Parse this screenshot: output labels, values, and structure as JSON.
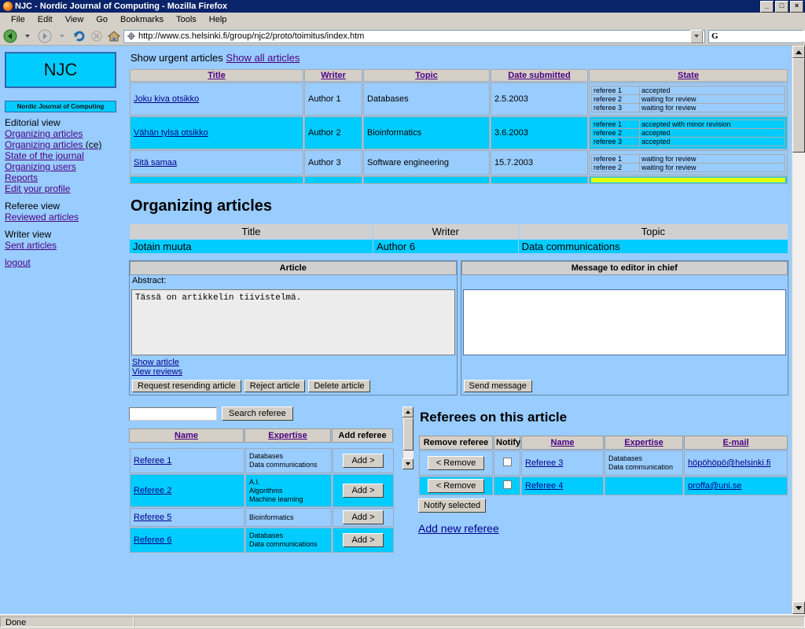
{
  "window": {
    "title": "NJC - Nordic Journal of Computing - Mozilla Firefox",
    "minimize_label": "_",
    "maximize_label": "□",
    "close_label": "×"
  },
  "menubar": {
    "items": [
      "File",
      "Edit",
      "View",
      "Go",
      "Bookmarks",
      "Tools",
      "Help"
    ]
  },
  "navbar": {
    "url": "http://www.cs.helsinki.fi/group/njc2/proto/toimitus/index.htm",
    "search_placeholder": "",
    "search_value": "",
    "google_icon_label": "G"
  },
  "sidebar": {
    "logo": "NJC",
    "subtitle": "Nordic Journal of Computing",
    "groups": [
      {
        "heading": "Editorial view",
        "links": [
          {
            "label": "Organizing articles",
            "suffix": ""
          },
          {
            "label": "Organizing articles",
            "suffix": " (ce)"
          },
          {
            "label": "State of the journal",
            "suffix": ""
          },
          {
            "label": "Organizing users",
            "suffix": ""
          },
          {
            "label": "Reports",
            "suffix": ""
          },
          {
            "label": "Edit your profile",
            "suffix": ""
          }
        ]
      },
      {
        "heading": "Referee view",
        "links": [
          {
            "label": "Reviewed articles",
            "suffix": ""
          }
        ]
      },
      {
        "heading": "Writer view",
        "links": [
          {
            "label": "Sent articles",
            "suffix": ""
          }
        ]
      }
    ],
    "logout": "logout"
  },
  "main": {
    "show_urgent_label": "Show urgent articles",
    "show_all_label": "Show all articles",
    "articles_table": {
      "headers": [
        "Title",
        "Writer",
        "Topic",
        "Date submitted",
        "State"
      ],
      "rows": [
        {
          "title": "Joku kiva otsikko",
          "writer": "Author 1",
          "topic": "Databases",
          "date": "2.5.2003",
          "states": [
            {
              "referee": "referee 1",
              "state": "accepted",
              "kind": "accepted"
            },
            {
              "referee": "referee 2",
              "state": "waiting for review",
              "kind": "waiting"
            },
            {
              "referee": "referee 3",
              "state": "waiting for review",
              "kind": "waiting"
            }
          ]
        },
        {
          "title": "Vähän tylsä otsikko",
          "writer": "Author 2",
          "topic": "Bioinformatics",
          "date": "3.6.2003",
          "states": [
            {
              "referee": "referee 1",
              "state": "accepted with minor revision",
              "kind": "accepted"
            },
            {
              "referee": "referee 2",
              "state": "accepted",
              "kind": "accepted"
            },
            {
              "referee": "referee 3",
              "state": "accepted",
              "kind": "accepted"
            }
          ]
        },
        {
          "title": "Sitä samaa",
          "writer": "Author 3",
          "topic": "Software engineering",
          "date": "15.7.2003",
          "states": [
            {
              "referee": "referee 1",
              "state": "waiting for review",
              "kind": "waiting"
            },
            {
              "referee": "referee 2",
              "state": "waiting for review",
              "kind": "waiting"
            }
          ]
        }
      ]
    },
    "section_title": "Organizing articles",
    "selected_article": {
      "headers": [
        "Title",
        "Writer",
        "Topic"
      ],
      "title": "Jotain muuta",
      "writer": "Author 6",
      "topic": "Data communications"
    },
    "article_panel": {
      "header": "Article",
      "abstract_label": "Abstract:",
      "abstract_text": "Tässä on artikkelin tiivistelmä.",
      "show_article_link": "Show article",
      "view_reviews_link": "View reviews",
      "buttons": [
        "Request resending article",
        "Reject article",
        "Delete article"
      ]
    },
    "message_panel": {
      "header": "Message to editor in chief",
      "textarea_value": "",
      "send_button": "Send message"
    },
    "referee_search": {
      "input_value": "",
      "search_button": "Search referee",
      "headers": [
        "Name",
        "Expertise",
        "Add referee"
      ],
      "rows": [
        {
          "name": "Referee 1",
          "expertise": [
            "Databases",
            "Data communications"
          ],
          "add_button": "Add >"
        },
        {
          "name": "Referee 2",
          "expertise": [
            "A.I.",
            "Algorithms",
            "Machine learning"
          ],
          "add_button": "Add >"
        },
        {
          "name": "Referee 5",
          "expertise": [
            "Bioinformatics"
          ],
          "add_button": "Add >"
        },
        {
          "name": "Referee 6",
          "expertise": [
            "Databases",
            "Data communications"
          ],
          "add_button": "Add >"
        }
      ]
    },
    "referees_on_article": {
      "title": "Referees on this article",
      "headers": [
        "Remove referee",
        "Notify",
        "Name",
        "Expertise",
        "E-mail"
      ],
      "rows": [
        {
          "remove_button": "< Remove",
          "checked": false,
          "name": "Referee 3",
          "expertise": [
            "Databases",
            "Data communication"
          ],
          "email": "höpöhöpö@helsinki.fi"
        },
        {
          "remove_button": "< Remove",
          "checked": false,
          "name": "Referee 4",
          "expertise": [],
          "email": "proffa@uni.se"
        }
      ],
      "notify_selected_button": "Notify selected",
      "add_new_referee_link": "Add new referee"
    }
  },
  "statusbar": {
    "text": "Done"
  },
  "colors": {
    "page_bg": "#99ccff",
    "row_alt": "#00ccff",
    "header_gray": "#d4d0c8",
    "accepted": "#00ee00",
    "waiting": "#ffff00",
    "link": "#00008b",
    "nav_link": "#4b0082"
  }
}
